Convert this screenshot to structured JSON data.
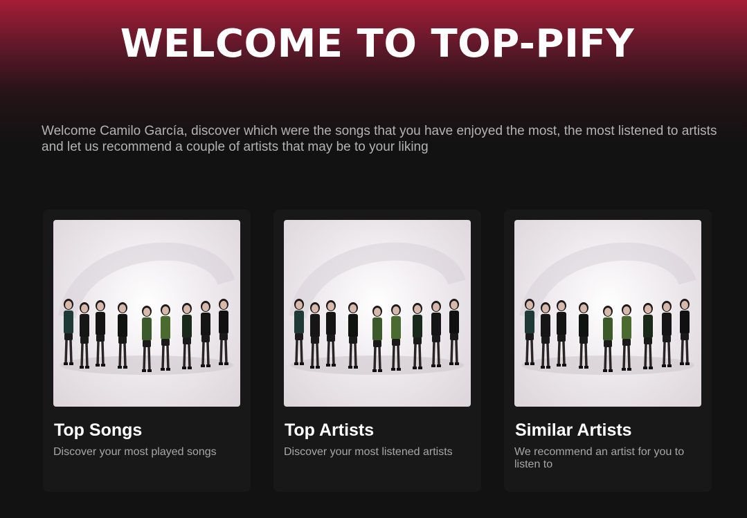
{
  "header": {
    "title": "WELCOME TO TOP-PIFY"
  },
  "intro": {
    "text": "Welcome Camilo García, discover which were the songs that you have enjoyed the most, the most listened to artists and let us recommend a couple of artists that may be to your liking"
  },
  "cards": [
    {
      "title": "Top Songs",
      "description": "Discover your most played songs",
      "image": "group-photo-image"
    },
    {
      "title": "Top Artists",
      "description": "Discover your most listened artists",
      "image": "group-photo-image"
    },
    {
      "title": "Similar Artists",
      "description": "We recommend an artist for you to listen to",
      "image": "group-photo-image"
    }
  ],
  "colors": {
    "accent": "#a51d36",
    "background": "#121212",
    "card": "#181818",
    "text_primary": "#ffffff",
    "text_secondary": "#b3b3b3"
  }
}
